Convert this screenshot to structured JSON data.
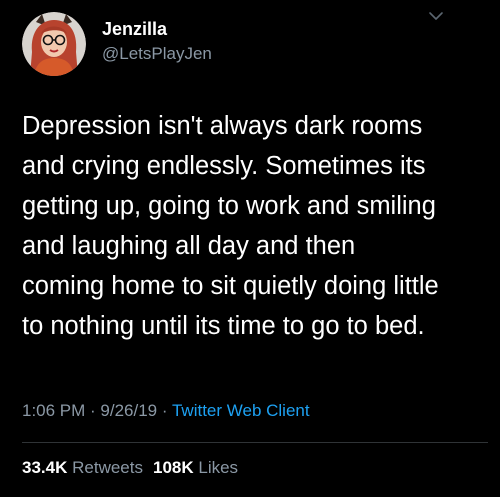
{
  "user": {
    "display_name": "Jenzilla",
    "handle": "@LetsPlayJen",
    "avatar_icon": "profile-photo"
  },
  "menu_icon": "chevron-down-icon",
  "tweet": {
    "lines": [
      "Depression isn't always dark rooms",
      "and crying endlessly. Sometimes its",
      "getting up, going to work and smiling",
      "and laughing all day and then",
      "coming home to sit quietly doing little",
      "to nothing until its time to go to bed."
    ]
  },
  "meta": {
    "time": "1:06 PM",
    "sep1": " · ",
    "date": "9/26/19",
    "sep2": " · ",
    "source": "Twitter Web Client"
  },
  "stats": {
    "retweets_count": "33.4K",
    "retweets_label": "Retweets",
    "likes_count": "108K",
    "likes_label": "Likes"
  },
  "colors": {
    "background": "#000000",
    "text": "#ffffff",
    "secondary": "#8b98a5",
    "link": "#1da1f2"
  }
}
